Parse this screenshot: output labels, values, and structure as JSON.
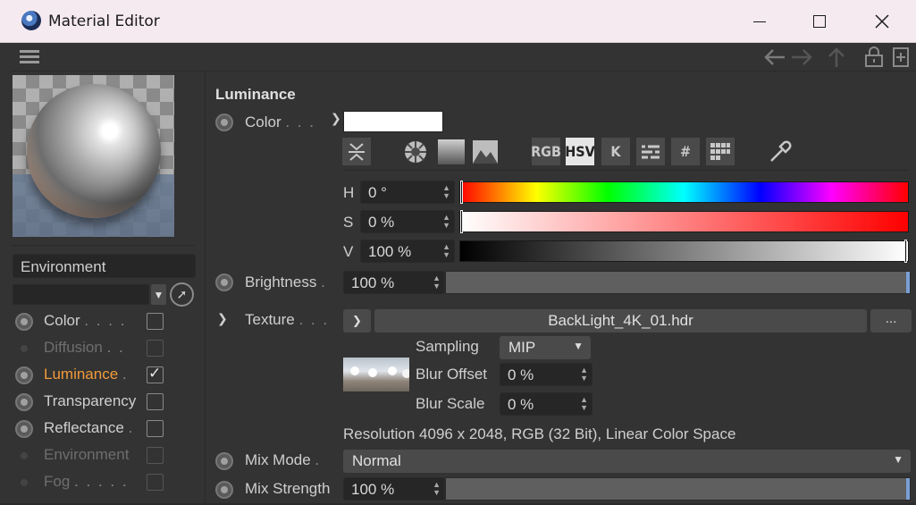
{
  "window": {
    "title": "Material Editor"
  },
  "left": {
    "environment_field": "Environment",
    "channels": [
      {
        "label": "Color",
        "dots": ". . . .",
        "enabled": true,
        "checked": false
      },
      {
        "label": "Diffusion",
        "dots": ". .",
        "enabled": false,
        "checked": false
      },
      {
        "label": "Luminance",
        "dots": ".",
        "enabled": true,
        "checked": true
      },
      {
        "label": "Transparency",
        "dots": "",
        "enabled": true,
        "checked": false
      },
      {
        "label": "Reflectance",
        "dots": ".",
        "enabled": true,
        "checked": false
      },
      {
        "label": "Environment",
        "dots": "",
        "enabled": false,
        "checked": false
      },
      {
        "label": "Fog",
        "dots": ". . . . .",
        "enabled": false,
        "checked": false
      }
    ]
  },
  "luminance": {
    "section_title": "Luminance",
    "color_label": "Color",
    "color_dots": ". . .",
    "color_value": "#ffffff",
    "mode_buttons": [
      "RGB",
      "HSV",
      "K",
      "#"
    ],
    "hsv": {
      "h_label": "H",
      "h_value": "0 °",
      "s_label": "S",
      "s_value": "0 %",
      "v_label": "V",
      "v_value": "100 %"
    },
    "brightness_label": "Brightness",
    "brightness_dots": ".",
    "brightness_value": "100 %",
    "texture_label": "Texture",
    "texture_dots": ". . .",
    "texture_file": "BackLight_4K_01.hdr",
    "texture_more": "...",
    "sampling_label": "Sampling",
    "sampling_value": "MIP",
    "blur_offset_label": "Blur Offset",
    "blur_offset_value": "0 %",
    "blur_scale_label": "Blur Scale",
    "blur_scale_value": "0 %",
    "resolution_text": "Resolution 4096 x 2048, RGB (32 Bit), Linear Color Space",
    "mix_mode_label": "Mix Mode",
    "mix_mode_dots": ".",
    "mix_mode_value": "Normal",
    "mix_strength_label": "Mix Strength",
    "mix_strength_value": "100 %"
  },
  "accent_color": "#f29a3a"
}
